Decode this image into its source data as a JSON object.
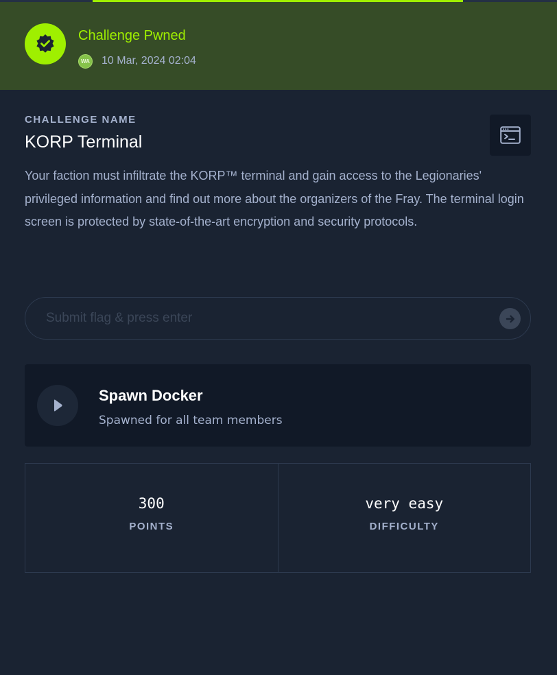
{
  "banner": {
    "title": "Challenge Pwned",
    "avatar_initials": "WA",
    "date": "10 Mar, 2024 02:04",
    "icon": "verified-badge-icon"
  },
  "challenge": {
    "section_label": "CHALLENGE NAME",
    "name": "KORP Terminal",
    "description": "Your faction must infiltrate the KORP™ terminal and gain access to the Legionaries' privileged information and find out more about the organizers of the Fray. The terminal login screen is protected by state-of-the-art encryption and security protocols.",
    "terminal_icon": "terminal-icon"
  },
  "flag": {
    "placeholder": "Submit flag & press enter",
    "value": "",
    "submit_icon": "arrow-right-icon"
  },
  "spawn": {
    "title": "Spawn Docker",
    "subtitle": "Spawned for all team members",
    "icon": "play-icon"
  },
  "stats": [
    {
      "value": "300",
      "label": "POINTS"
    },
    {
      "value": "very easy",
      "label": "DIFFICULTY"
    }
  ],
  "colors": {
    "accent": "#9fef00",
    "banner_bg": "#364c27",
    "page_bg": "#1a2332",
    "card_bg": "#111927",
    "muted_text": "#a4b1cd"
  }
}
